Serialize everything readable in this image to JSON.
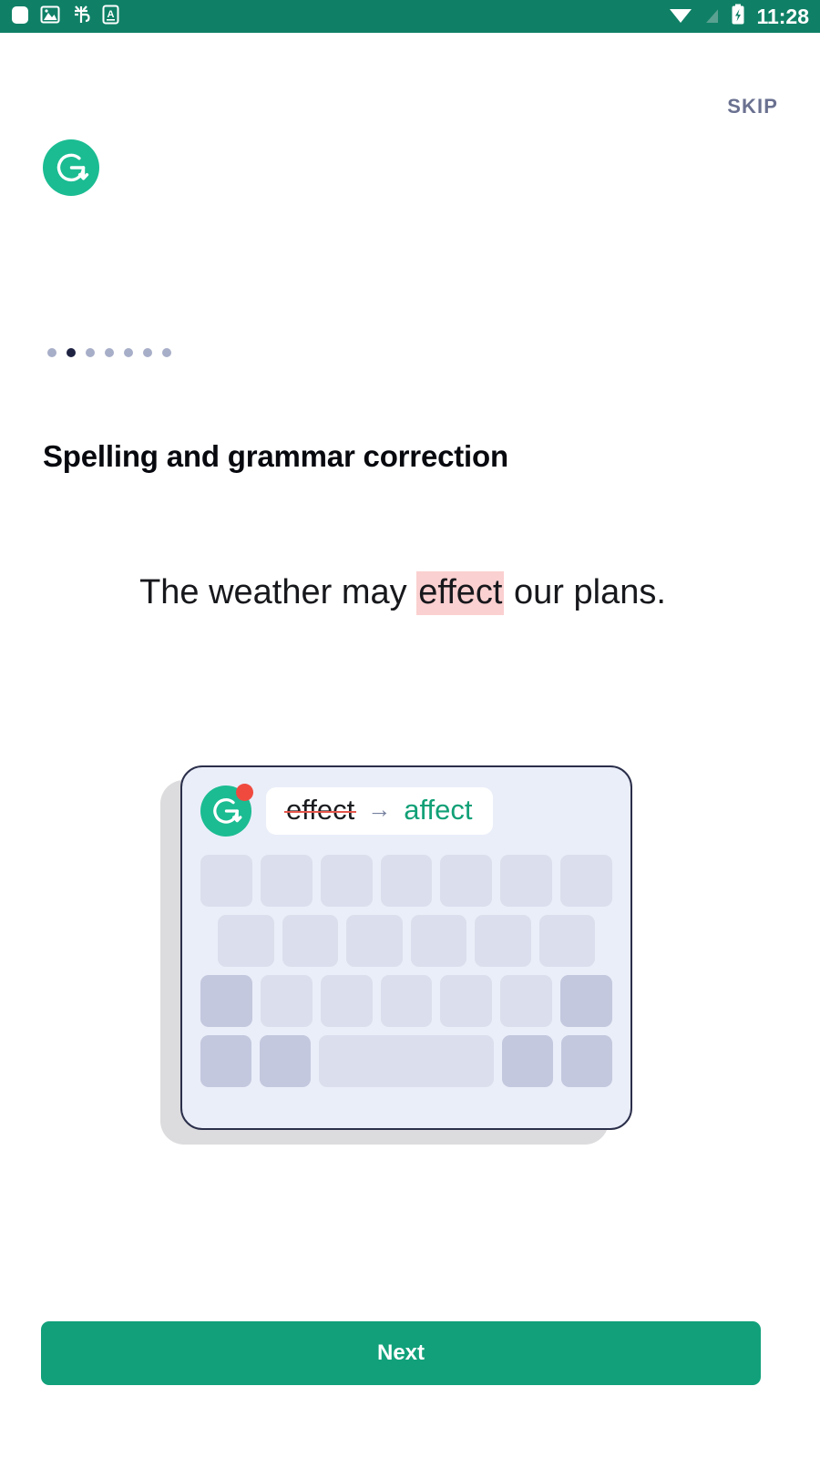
{
  "status_bar": {
    "background": "#0f8066",
    "time": "11:28",
    "left_icons": [
      {
        "name": "rounded-square-icon",
        "glyph": "▢"
      },
      {
        "name": "image-icon",
        "glyph": "🖼"
      },
      {
        "name": "debug-bug-icon",
        "glyph": "🐞"
      },
      {
        "name": "letter-a-icon",
        "glyph": "A"
      }
    ],
    "right_icons": [
      {
        "name": "wifi-icon"
      },
      {
        "name": "no-sim-signal-icon"
      },
      {
        "name": "battery-charging-icon"
      }
    ]
  },
  "header": {
    "skip_label": "SKIP",
    "skip_color": "#6a7190",
    "logo_name": "grammarly-logo",
    "brand_color": "#1bbc92"
  },
  "pager": {
    "total": 7,
    "active_index": 1,
    "dot_color": "#a7aec8",
    "active_dot_color": "#1e2342"
  },
  "main": {
    "title": "Spelling and grammar correction",
    "sample": {
      "before_text": "The weather may ",
      "highlight_text": "effect",
      "after_text": " our plans.",
      "highlight_color": "#fbd0d0"
    }
  },
  "keyboard_illustration": {
    "suggestion": {
      "logo_name": "grammarly-logo-badged",
      "badge_color": "#f04a3f",
      "from_word": "effect",
      "arrow": "→",
      "to_word": "affect",
      "from_strike_color": "#e6554b",
      "to_color": "#12a077"
    },
    "card_background": "#eaeef9",
    "card_border": "#2b2f4a",
    "key_color": "#dbdeec",
    "key_dark_color": "#c3c8de",
    "rows": [
      {
        "keys": [
          "k",
          "k",
          "k",
          "k",
          "k",
          "k",
          "k"
        ],
        "dark": []
      },
      {
        "keys": [
          "k",
          "k",
          "k",
          "k",
          "k",
          "k"
        ],
        "dark": [],
        "indent": true
      },
      {
        "keys": [
          "k",
          "k",
          "k",
          "k",
          "k",
          "k",
          "k"
        ],
        "dark": [
          0,
          6
        ]
      },
      {
        "keys": [
          "k",
          "k",
          "space",
          "k",
          "k"
        ],
        "dark": [
          0,
          1,
          3,
          4
        ]
      }
    ]
  },
  "footer": {
    "next_label": "Next",
    "next_color": "#11a07a"
  }
}
